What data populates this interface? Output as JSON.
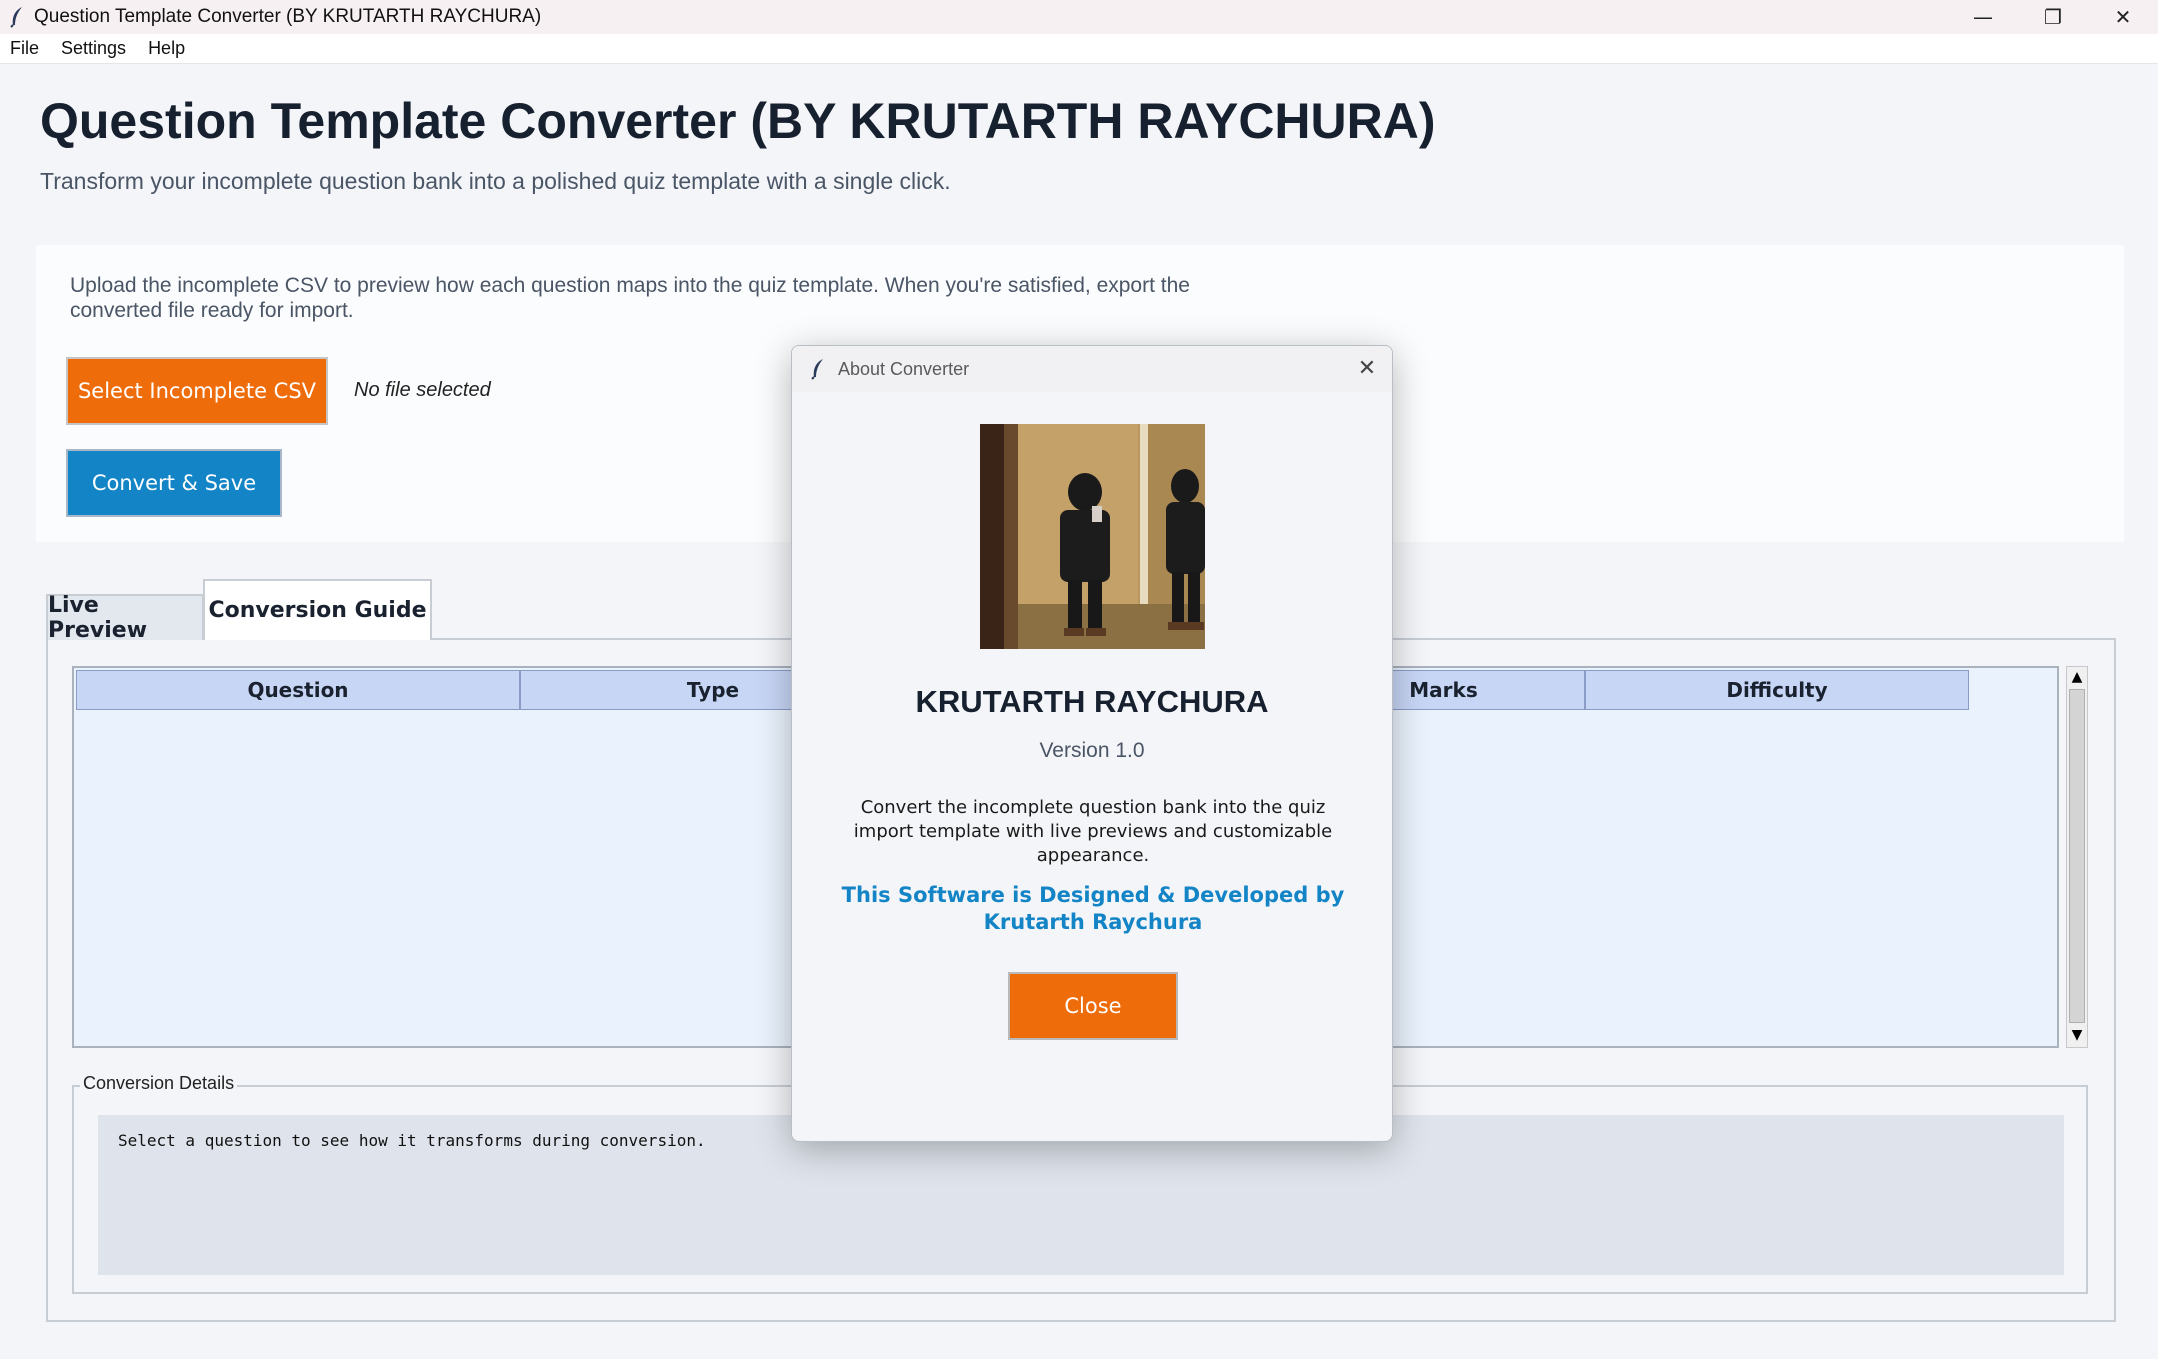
{
  "window": {
    "title": "Question Template Converter (BY KRUTARTH RAYCHURA)",
    "controls": {
      "minimize": "—",
      "restore": "❐",
      "close": "✕"
    }
  },
  "menu": {
    "file": "File",
    "settings": "Settings",
    "help": "Help"
  },
  "header": {
    "title": "Question Template Converter (BY KRUTARTH RAYCHURA)",
    "subtitle": "Transform your incomplete question bank into a polished quiz template with a single click."
  },
  "upload": {
    "description": "Upload the incomplete CSV to preview how each question maps into the quiz template. When you're satisfied, export the converted file ready for import.",
    "select_button": "Select Incomplete CSV",
    "file_status": "No file selected",
    "convert_button": "Convert & Save"
  },
  "tabs": {
    "live_preview": "Live Preview",
    "conversion_guide": "Conversion Guide"
  },
  "table": {
    "columns": [
      "Question",
      "Type",
      "",
      "Marks",
      "Difficulty"
    ],
    "rows": []
  },
  "details": {
    "legend": "Conversion Details",
    "text": "Select a question to see how it transforms during conversion."
  },
  "about_dialog": {
    "title": "About Converter",
    "name": "KRUTARTH RAYCHURA",
    "version": "Version 1.0",
    "description": "Convert the incomplete question bank into the quiz import template with live previews and customizable appearance.",
    "credit": "This Software is Designed & Developed by Krutarth Raychura",
    "close_button": "Close"
  },
  "colors": {
    "accent_orange": "#ef6c0b",
    "accent_blue": "#1384c6",
    "table_header": "#c8d6f6",
    "table_body": "#eaf2fd"
  },
  "icons": [
    "feather-icon",
    "minimize-icon",
    "restore-icon",
    "close-icon",
    "scroll-up-icon",
    "scroll-down-icon"
  ]
}
